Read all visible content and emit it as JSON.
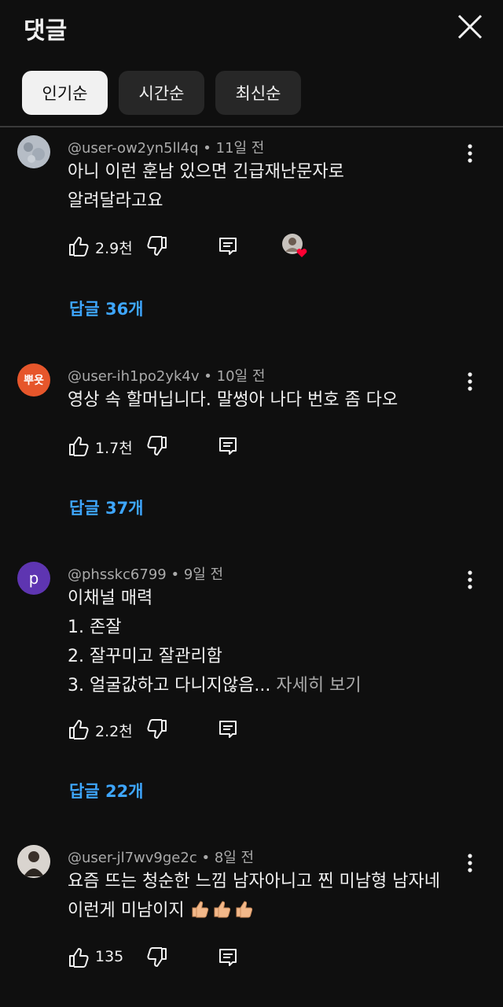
{
  "header": {
    "title": "댓글",
    "close_icon": "close-icon"
  },
  "chips": [
    {
      "label": "인기순",
      "active": true
    },
    {
      "label": "시간순",
      "active": false
    },
    {
      "label": "최신순",
      "active": false
    }
  ],
  "comments": [
    {
      "author": "@user-ow2yn5ll4q",
      "time": "11일 전",
      "lines": [
        "아니 이런 훈남 있으면 긴급재난문자로",
        "알려달라고요"
      ],
      "likes": "2.9천",
      "replies": "답글 36개",
      "creator_heart": true
    },
    {
      "author": "@user-ih1po2yk4v",
      "time": "10일 전",
      "avatar_text": "뿌욧",
      "lines": [
        "영상 속 할머닙니다. 말썽아 나다 번호 좀 다오"
      ],
      "likes": "1.7천",
      "replies": "답글 37개"
    },
    {
      "author": "@phsskc6799",
      "time": "9일 전",
      "avatar_text": "p",
      "lines": [
        "이채널 매력",
        "1. 존잘",
        "2. 잘꾸미고 잘관리함",
        "3. 얼굴값하고 다니지않음..."
      ],
      "read_more": "자세히 보기",
      "likes": "2.2천",
      "replies": "답글 22개"
    },
    {
      "author": "@user-jl7wv9ge2c",
      "time": "8일 전",
      "lines": [
        "요즘 뜨는 청순한 느낌 남자아니고 찐 미남형 남자네",
        "이런게 미남이지"
      ],
      "likes": "135"
    }
  ],
  "separator": "•",
  "colors": {
    "background": "#0f0f0f",
    "chip": "#272727",
    "link": "#3ea6ff",
    "meta": "#aaaaaa",
    "heart": "#ff0033"
  }
}
